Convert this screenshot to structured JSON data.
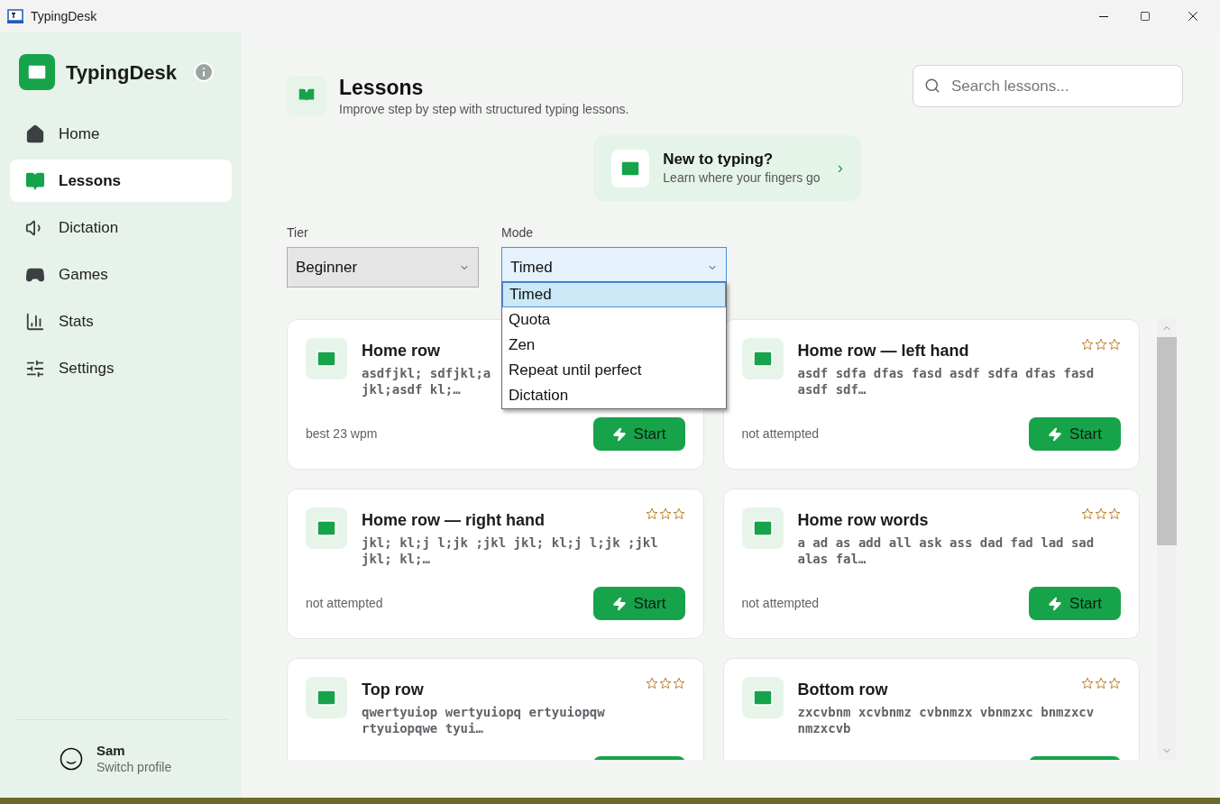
{
  "window": {
    "title": "TypingDesk"
  },
  "sidebar": {
    "app_name": "TypingDesk",
    "items": [
      {
        "label": "Home",
        "selected": false
      },
      {
        "label": "Lessons",
        "selected": true
      },
      {
        "label": "Dictation",
        "selected": false
      },
      {
        "label": "Games",
        "selected": false
      },
      {
        "label": "Stats",
        "selected": false
      },
      {
        "label": "Settings",
        "selected": false
      }
    ],
    "profile": {
      "name": "Sam",
      "action": "Switch profile"
    }
  },
  "header": {
    "title": "Lessons",
    "subtitle": "Improve step by step with structured typing lessons.",
    "search": {
      "placeholder": "Search lessons..."
    }
  },
  "banner": {
    "title": "New to typing?",
    "subtitle": "Learn where your fingers go",
    "chevron": "›"
  },
  "filters": [
    {
      "label": "Tier",
      "value": "Beginner",
      "open": false
    },
    {
      "label": "Mode",
      "value": "Timed",
      "open": true
    }
  ],
  "mode_options": [
    {
      "label": "Timed",
      "selected": true
    },
    {
      "label": "Quota",
      "selected": false
    },
    {
      "label": "Zen",
      "selected": false
    },
    {
      "label": "Repeat until perfect",
      "selected": false
    },
    {
      "label": "Dictation",
      "selected": false
    }
  ],
  "lessons": [
    {
      "title": "Home row",
      "preview": "asdfjkl; sdfjkl;a\njkl;asdf kl;…",
      "status": "best 23 wpm",
      "button": "Start"
    },
    {
      "title": "Home row — left hand",
      "preview": "asdf sdfa dfas fasd asdf sdfa dfas fasd asdf sdf…",
      "status": "not attempted",
      "button": "Start",
      "stars": 0
    },
    {
      "title": "Home row — right hand",
      "preview": "jkl; kl;j l;jk ;jkl jkl; kl;j l;jk ;jkl jkl; kl;…",
      "status": "not attempted",
      "button": "Start",
      "stars": 0
    },
    {
      "title": "Home row words",
      "preview": "a ad as add all ask ass dad fad lad sad alas fal…",
      "status": "not attempted",
      "button": "Start",
      "stars": 0
    },
    {
      "title": "Top row",
      "preview": "qwertyuiop wertyuiopq ertyuiopqw rtyuiopqwe tyui…",
      "stars": 0
    },
    {
      "title": "Bottom row",
      "preview": "zxcvbnm xcvbnmz cvbnmzx vbnmzxc bnmzxcv nmzxcvb",
      "stars": 0
    }
  ]
}
